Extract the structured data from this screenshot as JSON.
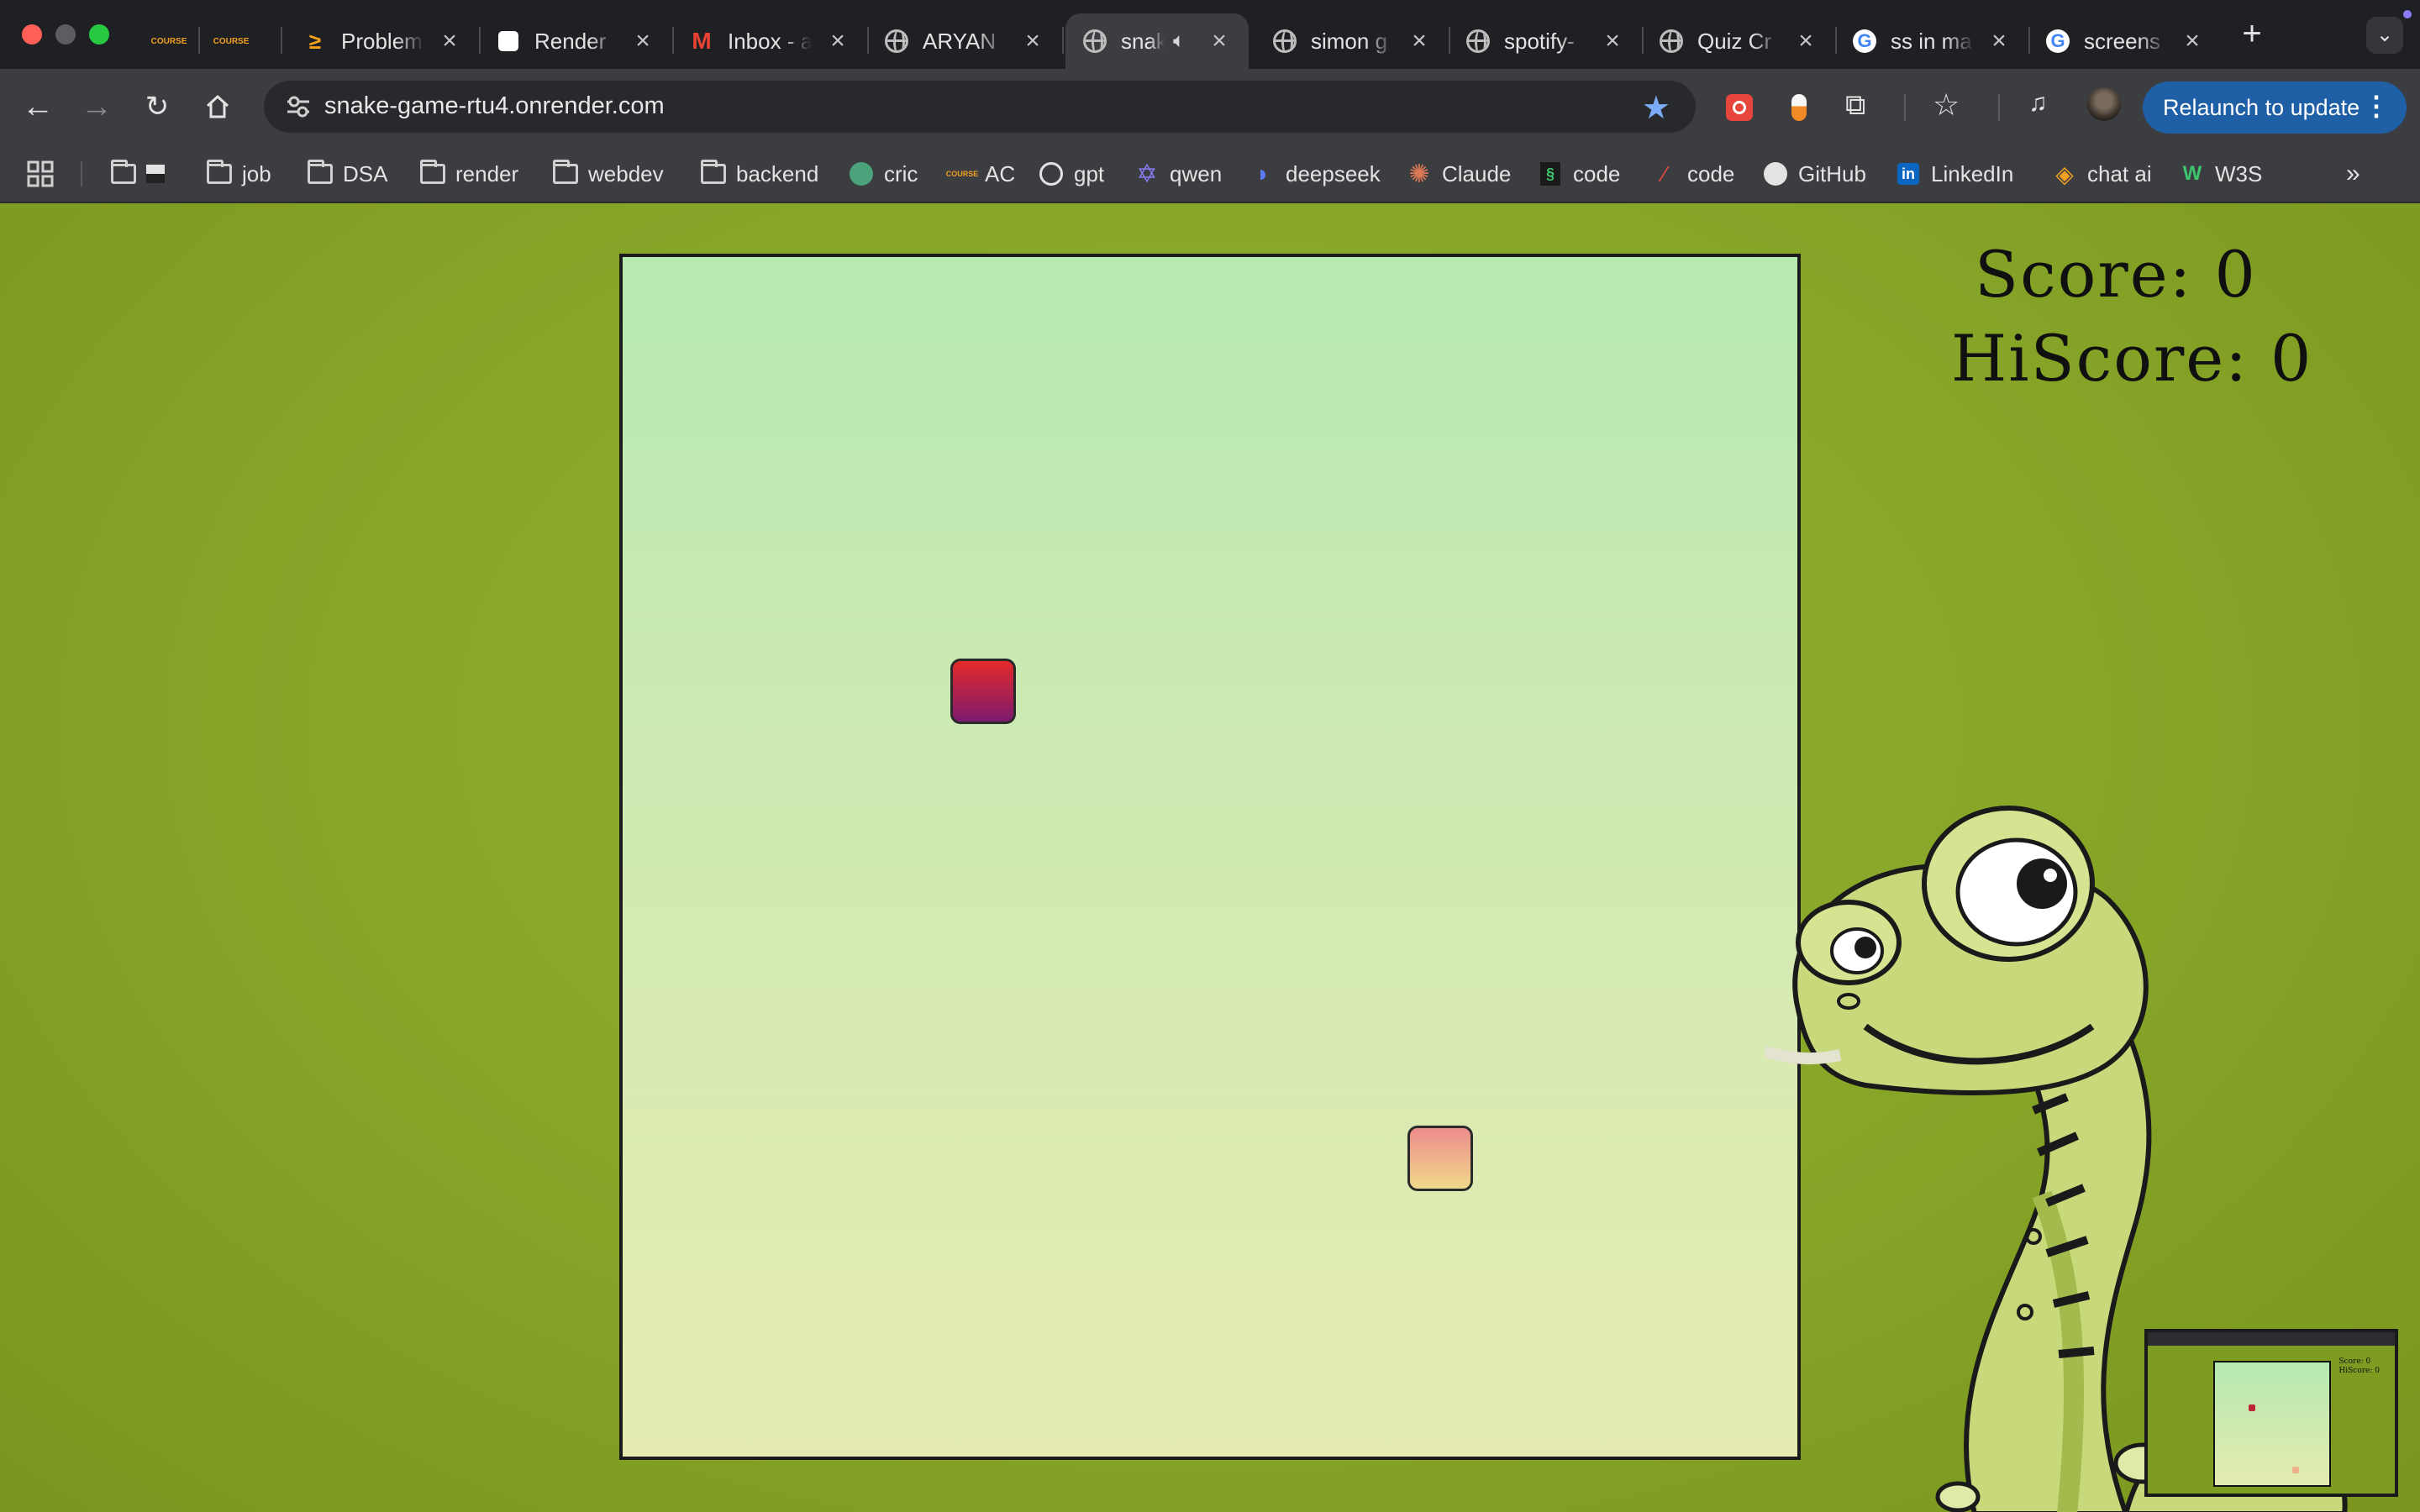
{
  "browser": {
    "tabs": [
      {
        "title": "",
        "favicon": "course-icon"
      },
      {
        "title": "",
        "favicon": "course-icon"
      },
      {
        "title": "Problem",
        "favicon": "leetcode-icon"
      },
      {
        "title": "Render",
        "favicon": "render-icon"
      },
      {
        "title": "Inbox - a",
        "favicon": "gmail-icon"
      },
      {
        "title": "ARYAN",
        "favicon": "globe-icon"
      },
      {
        "title": "snak",
        "favicon": "globe-icon",
        "active": true,
        "audio": true
      },
      {
        "title": "simon g",
        "favicon": "globe-icon"
      },
      {
        "title": "spotify-",
        "favicon": "globe-icon"
      },
      {
        "title": "Quiz Cr",
        "favicon": "globe-icon"
      },
      {
        "title": "ss in ma",
        "favicon": "google-icon"
      },
      {
        "title": "screens",
        "favicon": "google-icon"
      }
    ],
    "address_bar": {
      "url": "snake-game-rtu4.onrender.com"
    },
    "relaunch_label": "Relaunch to update",
    "bookmarks": [
      {
        "label": "job",
        "icon": "folder-icon"
      },
      {
        "label": "DSA",
        "icon": "folder-icon"
      },
      {
        "label": "render",
        "icon": "folder-icon"
      },
      {
        "label": "webdev",
        "icon": "folder-icon"
      },
      {
        "label": "backend",
        "icon": "folder-icon"
      },
      {
        "label": "cric",
        "icon": "cricbuzz-icon"
      },
      {
        "label": "AC",
        "icon": "course-icon"
      },
      {
        "label": "gpt",
        "icon": "openai-icon"
      },
      {
        "label": "qwen",
        "icon": "qwen-icon"
      },
      {
        "label": "deepseek",
        "icon": "deepseek-icon"
      },
      {
        "label": "Claude",
        "icon": "claude-icon"
      },
      {
        "label": "code",
        "icon": "code-icon"
      },
      {
        "label": "code",
        "icon": "codechef-icon"
      },
      {
        "label": "GitHub",
        "icon": "github-icon"
      },
      {
        "label": "LinkedIn",
        "icon": "linkedin-icon"
      },
      {
        "label": "chat ai",
        "icon": "chat-ai-icon"
      },
      {
        "label": "W3S",
        "icon": "w3schools-icon"
      }
    ]
  },
  "game": {
    "score_label": "Score: 0",
    "hiscore_label": "HiScore: 0",
    "colors": {
      "background": "#85a326",
      "board_top": "#b5eab0",
      "board_bottom": "#e5ebb0",
      "snake_head": "#e52a2a",
      "food": "#ee8c8c"
    }
  },
  "thumbnail": {
    "score_label": "Score: 0",
    "hiscore_label": "HiScore: 0"
  }
}
